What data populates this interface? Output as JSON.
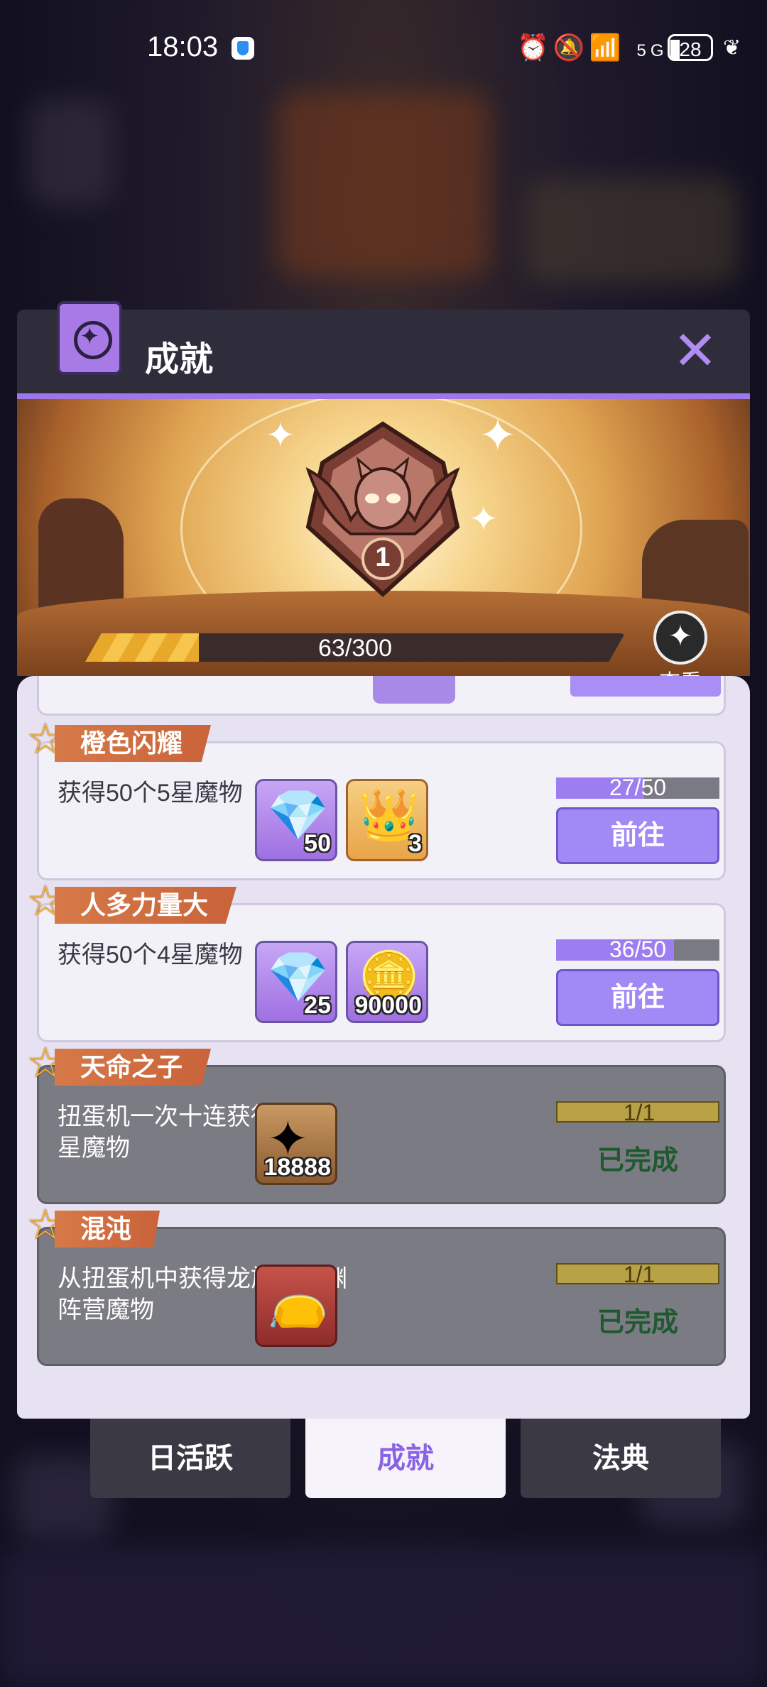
{
  "status": {
    "time": "18:03",
    "icons": "⏰🔕📶",
    "network": "5G",
    "battery": "28"
  },
  "dialog": {
    "title": "成就",
    "close_icon": "close-x-icon",
    "level": "1",
    "progress_text": "63/300",
    "progress_fraction": 0.21,
    "view_label": "查看"
  },
  "achievements": [
    {
      "name": "橙色闪耀",
      "desc": "获得50个5星魔物",
      "rewards": [
        {
          "icon": "purple-crystal-icon",
          "count": "50",
          "color": "purple"
        },
        {
          "icon": "gold-crown-badge-icon",
          "count": "3",
          "color": "orange"
        }
      ],
      "progress": "27/50",
      "progress_fraction": 0.54,
      "state": "active",
      "action": "前往"
    },
    {
      "name": "人多力量大",
      "desc": "获得50个4星魔物",
      "rewards": [
        {
          "icon": "purple-crystal-icon",
          "count": "25",
          "color": "purple"
        },
        {
          "icon": "silver-coin-icon",
          "count": "90000",
          "color": "purple"
        }
      ],
      "progress": "36/50",
      "progress_fraction": 0.72,
      "state": "active",
      "action": "前往"
    },
    {
      "name": "天命之子",
      "desc": "扭蛋机一次十连获得5个5星魔物",
      "rewards": [
        {
          "icon": "purple-star-shard-icon",
          "count": "18888",
          "color": "brown"
        }
      ],
      "progress": "1/1",
      "progress_fraction": 1,
      "state": "done",
      "action": "已完成"
    },
    {
      "name": "混沌",
      "desc": "从扭蛋机中获得龙族或深渊阵营魔物",
      "rewards": [
        {
          "icon": "mystery-bag-icon",
          "count": "",
          "color": "red"
        }
      ],
      "progress": "1/1",
      "progress_fraction": 1,
      "state": "done",
      "action": "已完成"
    }
  ],
  "tabs": [
    {
      "label": "日活跃",
      "active": false
    },
    {
      "label": "成就",
      "active": true
    },
    {
      "label": "法典",
      "active": false
    }
  ]
}
